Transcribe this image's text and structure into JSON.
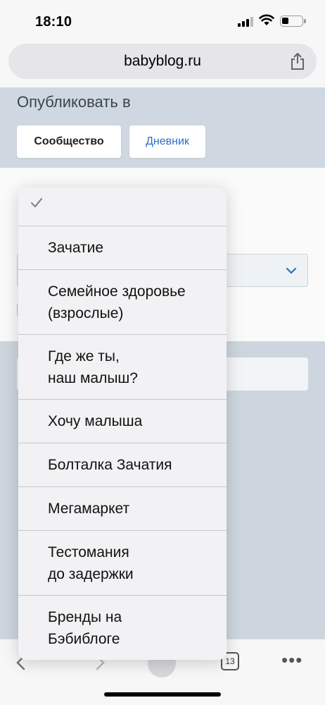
{
  "status": {
    "time": "18:10",
    "tab_count": "13"
  },
  "browser": {
    "url": "babyblog.ru"
  },
  "publish": {
    "title": "Опубликовать в",
    "community_label": "Сообщество",
    "diary_label": "Дневник"
  },
  "picker": {
    "options": [
      {
        "label": "",
        "selected": true
      },
      {
        "label": "Зачатие"
      },
      {
        "label": "Семейное здоровье\n(взрослые)"
      },
      {
        "label": "Где же ты,\nнаш малыш?"
      },
      {
        "label": "Хочу малыша"
      },
      {
        "label": "Болталка Зачатия"
      },
      {
        "label": "Мегамаркет"
      },
      {
        "label": "Тестомания\nдо задержки"
      },
      {
        "label": "Бренды на\nБэбиблоге"
      }
    ]
  },
  "icons": {
    "checkmark": "checkmark-icon",
    "chevron": "chevron-down-icon",
    "share": "share-icon",
    "back": "back-arrow-icon",
    "forward": "forward-arrow-icon",
    "tabs": "tabs-icon",
    "more": "more-icon"
  },
  "colors": {
    "accent": "#2f6fc4",
    "panel": "#cfd8e0"
  }
}
